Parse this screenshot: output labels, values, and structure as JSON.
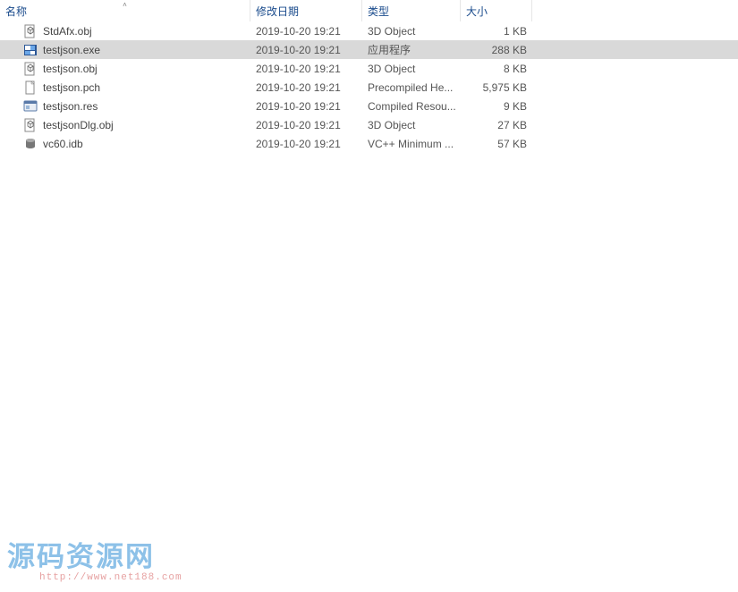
{
  "columns": {
    "name": "名称",
    "date": "修改日期",
    "type": "类型",
    "size": "大小"
  },
  "files": [
    {
      "name": "StdAfx.obj",
      "date": "2019-10-20 19:21",
      "type": "3D Object",
      "size": "1 KB",
      "icon": "obj",
      "selected": false
    },
    {
      "name": "testjson.exe",
      "date": "2019-10-20 19:21",
      "type": "应用程序",
      "size": "288 KB",
      "icon": "exe",
      "selected": true
    },
    {
      "name": "testjson.obj",
      "date": "2019-10-20 19:21",
      "type": "3D Object",
      "size": "8 KB",
      "icon": "obj",
      "selected": false
    },
    {
      "name": "testjson.pch",
      "date": "2019-10-20 19:21",
      "type": "Precompiled He...",
      "size": "5,975 KB",
      "icon": "file",
      "selected": false
    },
    {
      "name": "testjson.res",
      "date": "2019-10-20 19:21",
      "type": "Compiled Resou...",
      "size": "9 KB",
      "icon": "res",
      "selected": false
    },
    {
      "name": "testjsonDlg.obj",
      "date": "2019-10-20 19:21",
      "type": "3D Object",
      "size": "27 KB",
      "icon": "obj",
      "selected": false
    },
    {
      "name": "vc60.idb",
      "date": "2019-10-20 19:21",
      "type": "VC++ Minimum ...",
      "size": "57 KB",
      "icon": "idb",
      "selected": false
    }
  ],
  "watermark": {
    "text": "源码资源网",
    "url": "http://www.net188.com"
  }
}
